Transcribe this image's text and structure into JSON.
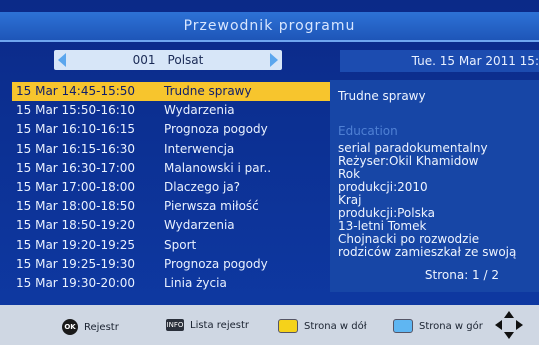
{
  "header": {
    "title": "Przewodnik programu"
  },
  "channel": {
    "number": "001",
    "name": "Polsat"
  },
  "date": "Tue. 15 Mar 2011 15:",
  "programs": [
    {
      "time": "15 Mar 14:45-15:50",
      "title": "Trudne sprawy",
      "selected": true
    },
    {
      "time": "15 Mar 15:50-16:10",
      "title": "Wydarzenia"
    },
    {
      "time": "15 Mar 16:10-16:15",
      "title": "Prognoza pogody"
    },
    {
      "time": "15 Mar 16:15-16:30",
      "title": "Interwencja"
    },
    {
      "time": "15 Mar 16:30-17:00",
      "title": "Malanowski i par.."
    },
    {
      "time": "15 Mar 17:00-18:00",
      "title": "Dlaczego ja?"
    },
    {
      "time": "15 Mar 18:00-18:50",
      "title": "Pierwsza miłość"
    },
    {
      "time": "15 Mar 18:50-19:20",
      "title": "Wydarzenia"
    },
    {
      "time": "15 Mar 19:20-19:25",
      "title": "Sport"
    },
    {
      "time": "15 Mar 19:25-19:30",
      "title": "Prognoza pogody"
    },
    {
      "time": "15 Mar 19:30-20:00",
      "title": "Linia życia"
    }
  ],
  "detail": {
    "title": "Trudne sprawy",
    "genre": "Education",
    "description": "serial paradokumentalny\nReżyser:Okil Khamidow\nRok\nprodukcji:2010\nKraj\nprodukcji:Polska\n13-letni Tomek\nChojnacki po rozwodzie\nrodziców zamieszkał ze swoją",
    "page": "Strona:  1 / 2"
  },
  "footer": {
    "ok_badge": "OK",
    "ok_label": "Rejestr",
    "info_badge": "INFO",
    "info_label": "Lista rejestr",
    "yellow_label": "Strona w dół",
    "blue_label": "Strona w gór",
    "colors": {
      "yellow": "#f5d21a",
      "blue": "#5fb6f2"
    }
  },
  "colors": {
    "background": "#0e3aa4",
    "highlight": "#f7c52d"
  }
}
